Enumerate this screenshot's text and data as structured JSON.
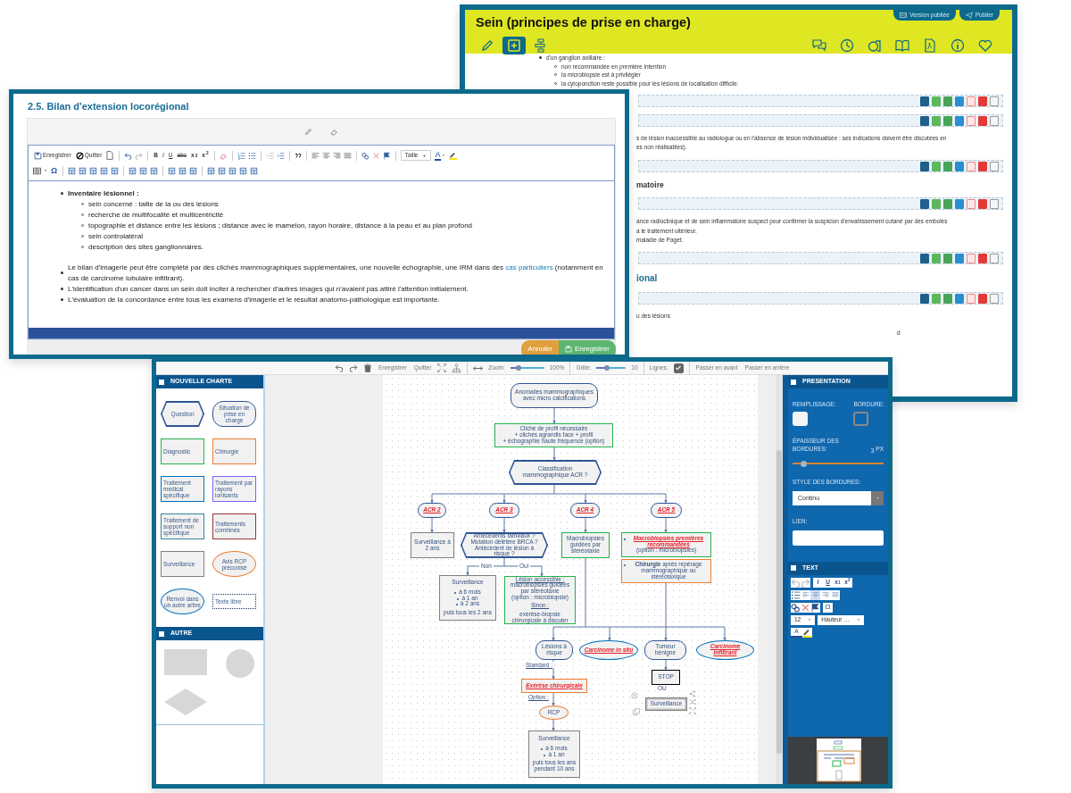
{
  "back_window": {
    "title": "Sein (principes de prise en charge)",
    "header_buttons": [
      {
        "kind": "published",
        "label": "Version publiée"
      },
      {
        "kind": "publish",
        "label": "Publier"
      }
    ],
    "mode_tabs": [
      {
        "selected": false
      },
      {
        "selected": true
      },
      {
        "selected": false
      }
    ],
    "list": {
      "text": "d'un ganglion axillaire :",
      "children": [
        {
          "text": "non recommandée en première intention"
        },
        {
          "text": "la microbiopsie est à privilégier"
        },
        {
          "text": "la cytoponction reste possible pour les lésions de localisation difficile."
        }
      ]
    },
    "blocks": [
      {
        "kind": "toolbar"
      },
      {
        "kind": "toolbar"
      },
      {
        "kind": "text",
        "lines": [
          "s de lésion inaccessible au radiologue ou en l'absence de lésion individualisée : ses indications doivent être discutées en",
          "es non réalisables)."
        ]
      },
      {
        "kind": "toolbar"
      },
      {
        "kind": "heading",
        "text": "matoire"
      },
      {
        "kind": "toolbar"
      },
      {
        "kind": "text",
        "lines": [
          "ance radioclinique et de sein inflammatoire suspect pour confirmer la suspicion d'envahissement cutané par des emboles",
          "a le traitement ultérieur.",
          "maladie de Paget."
        ]
      },
      {
        "kind": "toolbar"
      },
      {
        "kind": "section_title",
        "text": "ional"
      },
      {
        "kind": "toolbar"
      },
      {
        "kind": "text",
        "lines": [
          "u des lésions"
        ]
      },
      {
        "kind": "tail_text",
        "lines": [
          "d"
        ]
      }
    ]
  },
  "editor_window": {
    "title": "2.5. Bilan d'extension locorégional",
    "toolbar": {
      "save": "Enregistrer",
      "quit": "Quitter",
      "bold": "B",
      "italic": "I",
      "underline": "U",
      "strike": "abc",
      "subscript": "x$_{2}$",
      "superscript": "x$^{2}$",
      "size": "Taille",
      "color_letter": "A",
      "special": "Ω"
    },
    "content": [
      {
        "text": "Inventaire lésionnel :",
        "bold": true,
        "children": [
          {
            "text": "sein concerné : taille de la ou des lésions"
          },
          {
            "text": "recherche de multifocalité et multicentricité"
          },
          {
            "text": "topographie et distance entre les lésions ; distance avec le mamelon, rayon horaire, distance à la peau et au plan profond"
          },
          {
            "text": "sein controlatéral"
          },
          {
            "text": "description des sites ganglionnaires."
          }
        ]
      },
      {
        "text": "Le bilan d'imagerie peut être complété par des clichés mammographiques supplémentaires, une nouvelle échographie, une IRM dans des",
        "bold": false,
        "link": "cas particuliers",
        "after": "(notamment en cas de carcinome lobulaire infiltrant)."
      },
      {
        "text": "L'identification d'un cancer dans un sein doit inciter à rechercher d'autres images qui n'avaient pas attiré l'attention initialement.",
        "bold": false
      },
      {
        "text": "L'évaluation de la concordance entre tous les examens d'imagerie et le résultat anatomo-pathologique est importante.",
        "bold": false
      }
    ],
    "buttons": [
      {
        "kind": "cancel",
        "label": "Annuler"
      },
      {
        "kind": "save",
        "label": "Enregistrer"
      }
    ]
  },
  "flow_window": {
    "toolbar": {
      "save": "Enregistrer",
      "quit": "Quitter",
      "zoom_label": "Zoom:",
      "zoom": {
        "level": 0.25
      },
      "zoom_value": "100",
      "zoom_unit": "%",
      "grid_label": "Grille:",
      "grid": {
        "level": 0.35
      },
      "grid_value": "10",
      "lines_label": "Lignes:",
      "lines_checked": true,
      "forward": "Passer en avant",
      "backward": "Passer en arrière"
    },
    "palette": {
      "title": "NOUVELLE CHARTE",
      "shapes": [
        {
          "kind": "hexagon",
          "color": "#2f5597",
          "label": "Question"
        },
        {
          "kind": "pill",
          "color": "#2f5597",
          "label": "Situation de prise en charge"
        },
        {
          "kind": "rect",
          "color": "#22b14c",
          "label": "Diagnostic"
        },
        {
          "kind": "rect",
          "color": "#ed7d31",
          "label": "Chirurgie"
        },
        {
          "kind": "rect",
          "color": "#0070c0",
          "label": "Traitement médical spécifique"
        },
        {
          "kind": "rect",
          "color": "#7b61ff",
          "label": "Traitement par rayons ionisants"
        },
        {
          "kind": "rect",
          "color": "#31859c",
          "label": "Traitement de support non spécifique"
        },
        {
          "kind": "rect",
          "color": "#953735",
          "label": "Traitements combinés"
        },
        {
          "kind": "rect",
          "color": "#808080",
          "label": "Surveillance"
        },
        {
          "kind": "ellipse",
          "color": "#ed7d31",
          "label": "Avis RCP préconisé"
        },
        {
          "kind": "ellipse",
          "color": "#0070c0",
          "label": "Renvoi dans un autre arbre"
        },
        {
          "kind": "dotted",
          "color": "#1f3864",
          "label": "Texte libre"
        }
      ]
    },
    "other": {
      "title": "AUTRE",
      "shapes": [
        {
          "kind": "rect"
        },
        {
          "kind": "circle"
        },
        {
          "kind": "diamond"
        }
      ]
    },
    "nodes": [
      {
        "kind": "pill",
        "color": "#2f5597",
        "selected": false,
        "texts": [
          {
            "text": "Anomalies mammographiques avec micro calcifications"
          }
        ]
      },
      {
        "kind": "rect",
        "color": "#22b14c",
        "selected": false,
        "texts": [
          {
            "text": "Cliché de profil nécessaire"
          },
          {
            "text": "+ clichés agrandis face + profil"
          },
          {
            "text": "+ échographie haute fréquence (option)"
          }
        ]
      },
      {
        "kind": "hexagon",
        "color": "#2f5597",
        "selected": false,
        "texts": [
          {
            "text": "Classification mammographique ACR ?"
          }
        ]
      },
      {
        "kind": "pill",
        "color": "#2f5597",
        "selected": false,
        "texts": [
          {
            "kind": "link",
            "text": "ACR 2"
          }
        ]
      },
      {
        "kind": "pill",
        "color": "#2f5597",
        "selected": false,
        "texts": [
          {
            "kind": "link",
            "text": "ACR 3"
          }
        ]
      },
      {
        "kind": "pill",
        "color": "#2f5597",
        "selected": false,
        "texts": [
          {
            "kind": "link",
            "text": "ACR 4"
          }
        ]
      },
      {
        "kind": "pill",
        "color": "#2f5597",
        "selected": false,
        "texts": [
          {
            "kind": "link",
            "text": "ACR 5"
          }
        ]
      },
      {
        "kind": "rect",
        "color": "#808080",
        "selected": false,
        "texts": [
          {
            "text": "Surveillance à 2 ans"
          }
        ]
      },
      {
        "kind": "hexagon",
        "color": "#2f5597",
        "selected": false,
        "texts": [
          {
            "text": "Antécédents familiaux ? Mutation délétère BRCA ? Antécédent de lésion à risque ?"
          }
        ]
      },
      {
        "kind": "rect",
        "color": "#22b14c",
        "selected": false,
        "texts": [
          {
            "text": "Macrobiopsies guidées par stéréotaxie"
          }
        ]
      },
      {
        "kind": "rect",
        "color": "#22b14c",
        "selected": false,
        "texts": [
          {
            "kind": "bullet_link",
            "text": "Macrobiopsies premières recommandées"
          },
          {
            "text": "(option : microbiopsies)"
          }
        ]
      },
      {
        "kind": "rect",
        "color": "#ed7d31",
        "selected": false,
        "texts": [
          {
            "kind": "bullet",
            "text": "**Chirurgie** après repérage mammographique ou stéréotaxique"
          }
        ]
      },
      {
        "kind": "rect",
        "color": "#808080",
        "selected": false,
        "texts": [
          {
            "text": "Surveillance"
          },
          {
            "kind": "bullet",
            "text": "à 6 mois"
          },
          {
            "kind": "bullet",
            "text": "à 1 an"
          },
          {
            "kind": "bullet",
            "text": "à 2 ans"
          },
          {
            "text": "puis tous les 2 ans"
          }
        ]
      },
      {
        "kind": "rect",
        "color": "#22b14c",
        "selected": false,
        "texts": [
          {
            "kind": "underline",
            "text": "Lésion accessible :"
          },
          {
            "text": "macrobiopsies guidées par stéréotaxie"
          },
          {
            "text": "(option : microbiopsie)"
          },
          {
            "kind": "underline",
            "text": "Sinon :"
          },
          {
            "text": "exérèse-biopsie chirurgicale à discuter"
          }
        ]
      },
      {
        "kind": "pill",
        "color": "#2f5597",
        "selected": false,
        "texts": [
          {
            "text": "Lésions à risque"
          }
        ]
      },
      {
        "kind": "ellipse",
        "color": "#0070c0",
        "selected": false,
        "texts": [
          {
            "kind": "link",
            "text": "Carcinome in situ"
          }
        ]
      },
      {
        "kind": "pill",
        "color": "#2f5597",
        "selected": false,
        "texts": [
          {
            "text": "Tumeur bénigne"
          }
        ]
      },
      {
        "kind": "ellipse",
        "color": "#0070c0",
        "selected": false,
        "texts": [
          {
            "kind": "link",
            "text": "Carcinome infiltrant"
          }
        ]
      },
      {
        "kind": "label",
        "selected": false,
        "texts": [
          {
            "text": "Non"
          }
        ]
      },
      {
        "kind": "label",
        "selected": false,
        "texts": [
          {
            "text": "Oui"
          }
        ]
      },
      {
        "kind": "label",
        "selected": false,
        "texts": [
          {
            "kind": "underline",
            "text": "Standard :"
          }
        ]
      },
      {
        "kind": "rect",
        "color": "#ed7d31",
        "selected": false,
        "texts": [
          {
            "kind": "link",
            "text": "Exérèse chirurgicale"
          }
        ]
      },
      {
        "kind": "label",
        "selected": false,
        "texts": [
          {
            "kind": "underline",
            "text": "Option :"
          }
        ]
      },
      {
        "kind": "ellipse",
        "color": "#ed7d31",
        "selected": false,
        "texts": [
          {
            "text": "RCP"
          }
        ]
      },
      {
        "kind": "rect",
        "color": "#808080",
        "selected": false,
        "texts": [
          {
            "text": "Surveillance"
          },
          {
            "kind": "bullet",
            "text": "à 6 mois"
          },
          {
            "kind": "bullet",
            "text": "à 1 an"
          },
          {
            "text": "puis tous les ans pendant 10 ans"
          }
        ]
      },
      {
        "kind": "rect",
        "color": "#000000",
        "selected": false,
        "texts": [
          {
            "text": "STOP"
          }
        ]
      },
      {
        "kind": "label",
        "selected": false,
        "texts": [
          {
            "text": "OU"
          }
        ]
      },
      {
        "kind": "rect",
        "color": "#808080",
        "selected": true,
        "texts": [
          {
            "text": "Surveillance"
          }
        ]
      }
    ],
    "presentation": {
      "title": "PRESENTATION",
      "fill_label": "REMPLISSAGE:",
      "border_label": "BORDURE:",
      "thickness_label": "ÉPAISSEUR DES BORDURES:",
      "thickness_value": "3",
      "thickness_unit": "PX",
      "thickness": {
        "level": 0.12
      },
      "style_label": "STYLE DES BORDURES:",
      "style_value": "Continu",
      "link_label": "LIEN:"
    },
    "text_panel": {
      "title": "TEXT",
      "italic": "I",
      "underline": "U",
      "subscript": "x$_{1}$",
      "superscript": "x$^{2}$",
      "align": [
        {
          "selected": false
        },
        {
          "selected": true
        },
        {
          "selected": false
        },
        {
          "selected": false
        }
      ],
      "special": "Ω",
      "font_size": "12",
      "line_height": "Hauteur …",
      "color_letter": "A"
    }
  }
}
